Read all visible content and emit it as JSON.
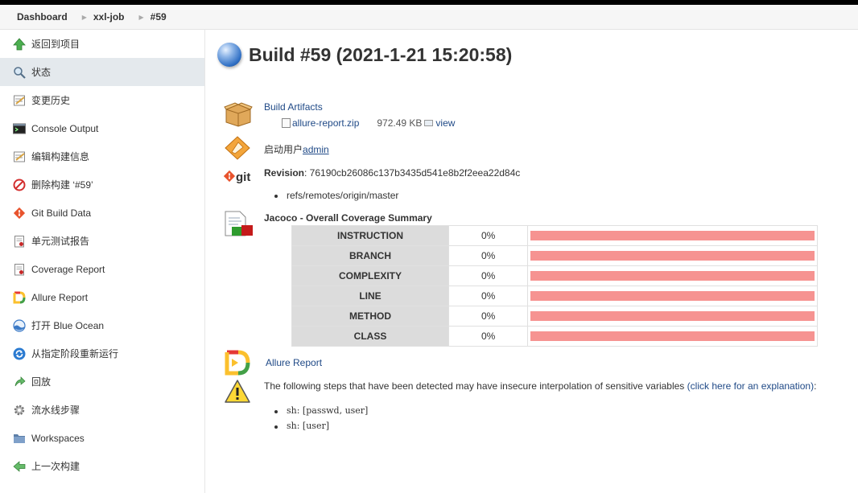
{
  "breadcrumb": {
    "items": [
      "Dashboard",
      "xxl-job",
      "#59"
    ]
  },
  "sidebar": {
    "items": [
      {
        "label": "返回到项目",
        "icon": "up-arrow-icon"
      },
      {
        "label": "状态",
        "icon": "magnifier-icon"
      },
      {
        "label": "变更历史",
        "icon": "notepad-icon"
      },
      {
        "label": "Console Output",
        "icon": "terminal-icon"
      },
      {
        "label": "编辑构建信息",
        "icon": "notepad-icon"
      },
      {
        "label": "删除构建 ‘#59’",
        "icon": "no-entry-icon"
      },
      {
        "label": "Git Build Data",
        "icon": "git-icon"
      },
      {
        "label": "单元测试报告",
        "icon": "clipboard-icon"
      },
      {
        "label": "Coverage Report",
        "icon": "clipboard-icon"
      },
      {
        "label": "Allure Report",
        "icon": "allure-icon"
      },
      {
        "label": "打开 Blue Ocean",
        "icon": "blue-ocean-icon"
      },
      {
        "label": "从指定阶段重新运行",
        "icon": "refresh-icon"
      },
      {
        "label": "回放",
        "icon": "replay-arrow-icon"
      },
      {
        "label": "流水线步骤",
        "icon": "gear-icon"
      },
      {
        "label": "Workspaces",
        "icon": "folder-icon"
      },
      {
        "label": "上一次构建",
        "icon": "left-arrow-icon"
      }
    ]
  },
  "main": {
    "title": "Build #59 (2021-1-21 15:20:58)",
    "artifacts": {
      "heading": "Build Artifacts",
      "file": "allure-report.zip",
      "size": "972.49 KB",
      "view": "view"
    },
    "started_by": {
      "prefix": "启动用户",
      "user": "admin"
    },
    "revision": {
      "label": "Revision",
      "hash": ": 76190cb26086c137b3435d541e8b2f2eea22d84c",
      "branch": "refs/remotes/origin/master"
    },
    "jacoco": {
      "title": "Jacoco - Overall Coverage Summary",
      "rows": [
        {
          "name": "INSTRUCTION",
          "pct": "0%"
        },
        {
          "name": "BRANCH",
          "pct": "0%"
        },
        {
          "name": "COMPLEXITY",
          "pct": "0%"
        },
        {
          "name": "LINE",
          "pct": "0%"
        },
        {
          "name": "METHOD",
          "pct": "0%"
        },
        {
          "name": "CLASS",
          "pct": "0%"
        }
      ]
    },
    "allure": {
      "label": "Allure Report"
    },
    "warning": {
      "text": "The following steps that have been detected may have insecure interpolation of sensitive variables ",
      "link": "(click here for an explanation)",
      "suffix": ":",
      "steps": [
        "sh: [passwd, user]",
        "sh: [user]"
      ]
    }
  }
}
